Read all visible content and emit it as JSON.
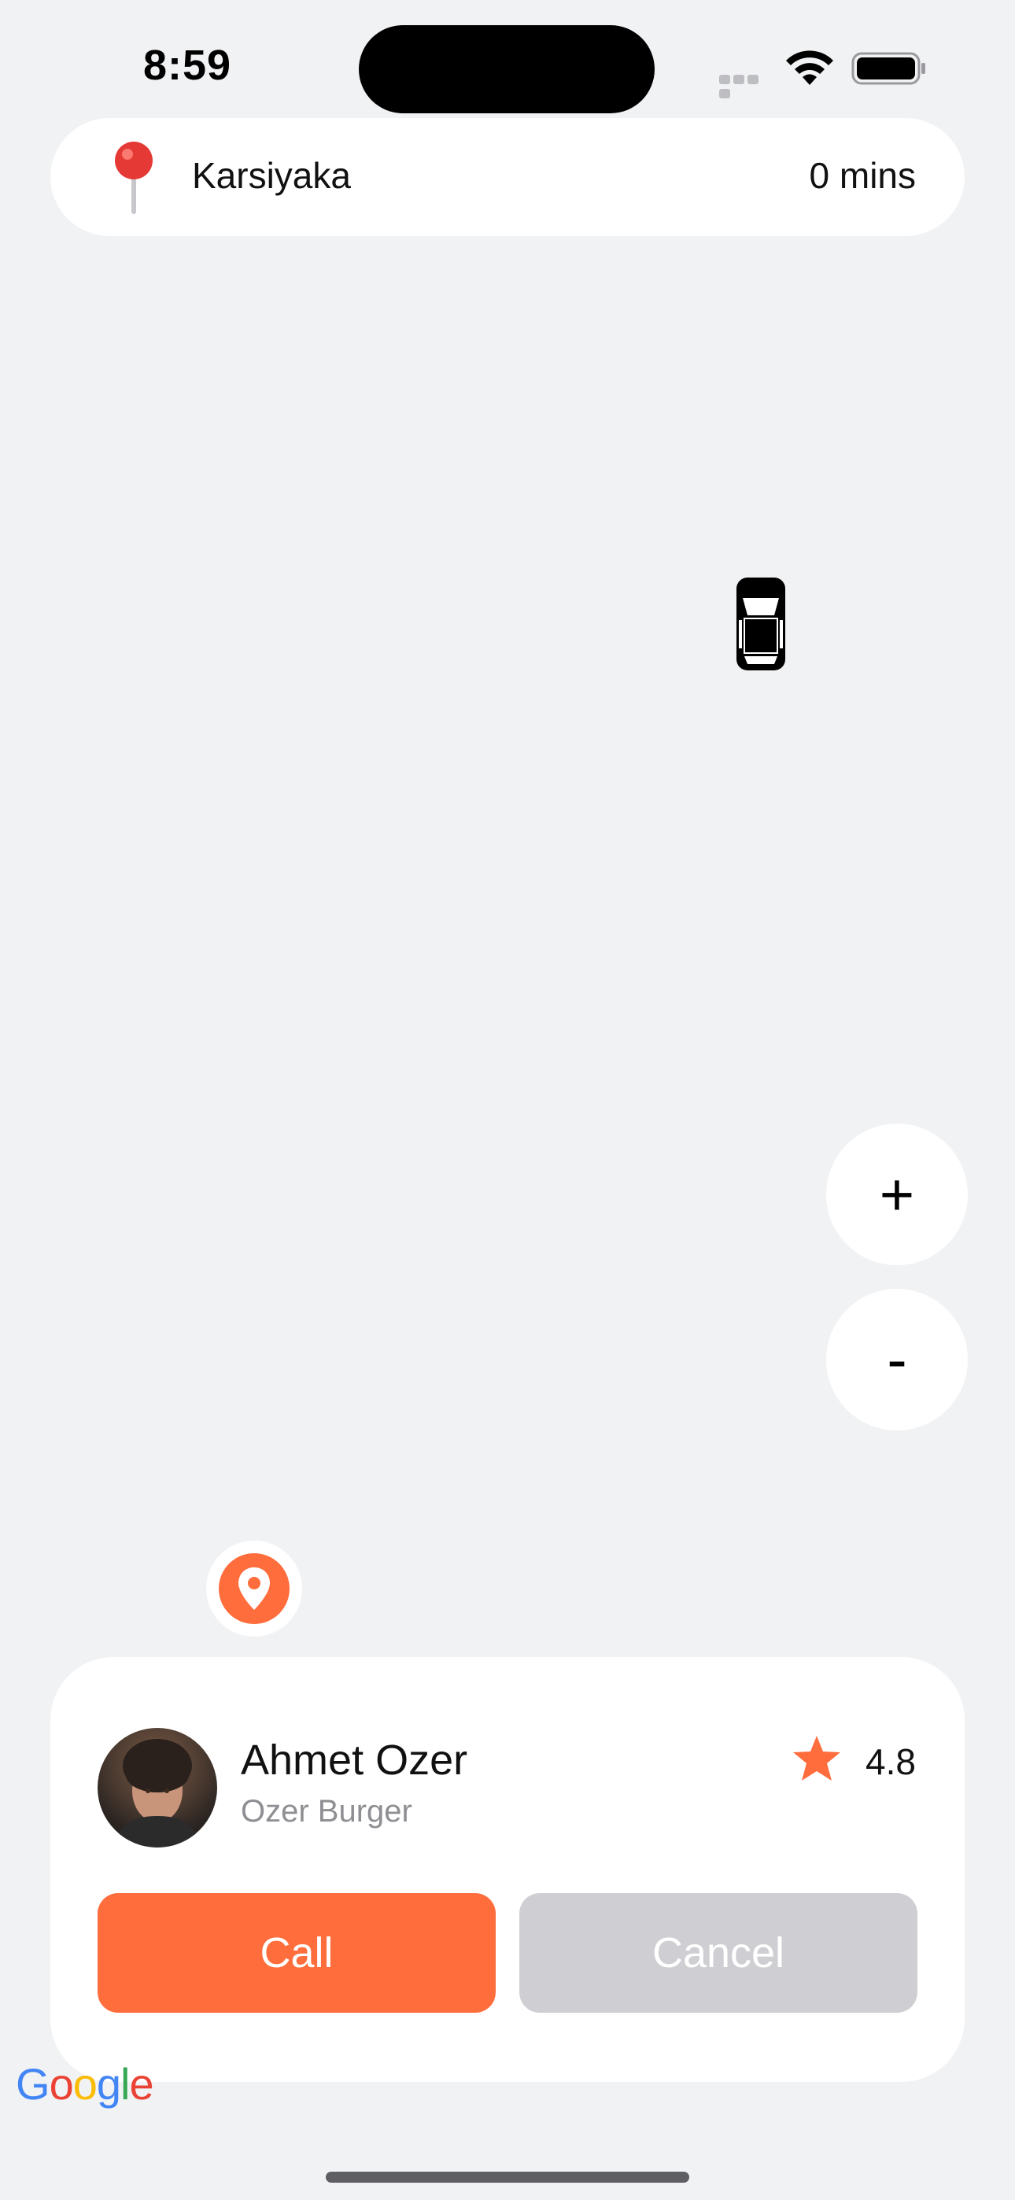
{
  "status_bar": {
    "time": "8:59"
  },
  "location_bar": {
    "place": "Karsiyaka",
    "eta": "0 mins"
  },
  "map": {
    "zoom_in_label": "+",
    "zoom_out_label": "-",
    "attribution": [
      "G",
      "o",
      "o",
      "g",
      "l",
      "e"
    ]
  },
  "driver": {
    "name": "Ahmet Ozer",
    "business": "Ozer Burger",
    "rating": "4.8"
  },
  "actions": {
    "call_label": "Call",
    "cancel_label": "Cancel"
  },
  "colors": {
    "accent": "#ff6d3c",
    "cancel_bg": "#cfcfd3",
    "map_bg": "#f1f2f4"
  }
}
